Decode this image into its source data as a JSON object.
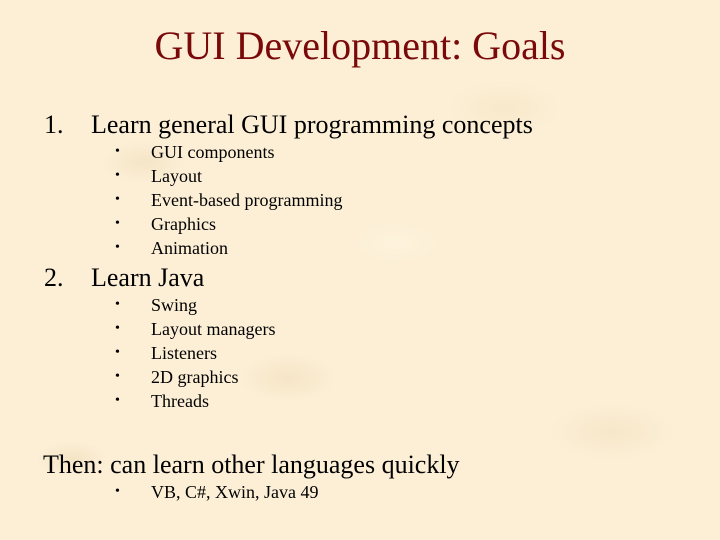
{
  "slide": {
    "title": "GUI Development:  Goals",
    "sections": [
      {
        "number": "1.",
        "heading": "Learn general GUI programming concepts",
        "bullets": [
          "GUI components",
          "Layout",
          "Event-based programming",
          "Graphics",
          "Animation"
        ]
      },
      {
        "number": "2.",
        "heading": "Learn Java",
        "bullets": [
          "Swing",
          "Layout managers",
          "Listeners",
          "2D graphics",
          "Threads"
        ]
      }
    ],
    "conclusion": {
      "heading": "Then:  can learn other languages quickly",
      "bullets": [
        "VB, C#,  Xwin, Java 49"
      ]
    },
    "bullet_glyph": "•",
    "colors": {
      "title": "#7a0a0a",
      "background": "#fcefd6",
      "text": "#000000"
    }
  }
}
